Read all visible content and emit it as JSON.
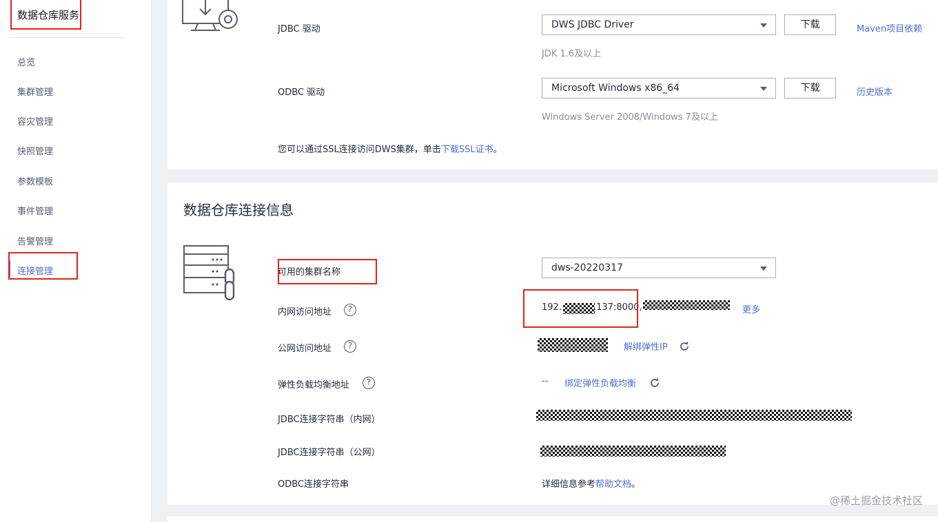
{
  "sidebar": {
    "title": "数据仓库服务",
    "items": [
      {
        "label": "总览"
      },
      {
        "label": "集群管理"
      },
      {
        "label": "容灾管理"
      },
      {
        "label": "快照管理"
      },
      {
        "label": "参数模板"
      },
      {
        "label": "事件管理"
      },
      {
        "label": "告警管理"
      },
      {
        "label": "连接管理",
        "active": true
      }
    ]
  },
  "drivers": {
    "jdbc": {
      "label": "JDBC 驱动",
      "selected": "DWS JDBC Driver",
      "download_label": "下载",
      "hint": "JDK 1.6及以上",
      "link": "Maven项目依赖"
    },
    "odbc": {
      "label": "ODBC 驱动",
      "selected": "Microsoft Windows x86_64",
      "download_label": "下载",
      "hint": "Windows Server 2008/Windows 7及以上",
      "link": "历史版本"
    },
    "ssl_note": "您可以通过SSL连接访问DWS集群，单击",
    "ssl_link": "下载SSL证书",
    "ssl_end": "。"
  },
  "connection": {
    "title": "数据仓库连接信息",
    "cluster": {
      "label": "可用的集群名称",
      "selected": "dws-20220317"
    },
    "private_address": {
      "label": "内网访问地址",
      "prefix": "192.",
      "suffix": ".137:8000,",
      "more": "更多"
    },
    "public_address": {
      "label": "公网访问地址",
      "action": "解绑弹性IP"
    },
    "elb_address": {
      "label": "弹性负载均衡地址",
      "value": "--",
      "action": "绑定弹性负载均衡"
    },
    "jdbc_private": {
      "label": "JDBC连接字符串（内网）"
    },
    "jdbc_public": {
      "label": "JDBC连接字符串（公网）"
    },
    "odbc": {
      "label": "ODBC连接字符串",
      "text": "详细信息参考",
      "link": "帮助文档",
      "end": "。"
    }
  },
  "watermark": "@稀土掘金技术社区",
  "colors": {
    "accent": "#526ecc",
    "highlight_box": "#e2231a",
    "text": "#252b3a",
    "muted": "#8a8e99"
  }
}
